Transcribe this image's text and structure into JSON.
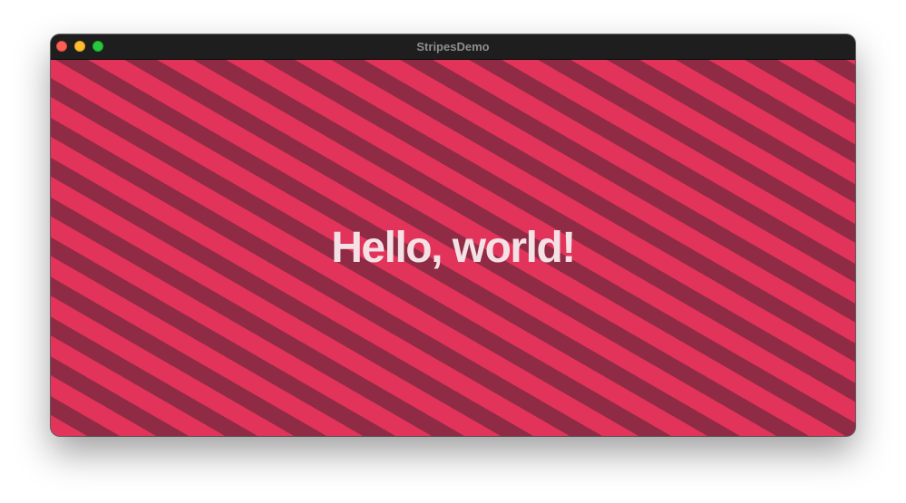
{
  "window": {
    "title": "StripesDemo",
    "controls": {
      "close": "close-button",
      "minimize": "minimize-button",
      "zoom": "zoom-button"
    }
  },
  "content": {
    "headline": "Hello, world!",
    "stripe_colors": {
      "light": "#e2335a",
      "dark": "#8f2b45"
    },
    "text_color": "#f4e1e6"
  }
}
